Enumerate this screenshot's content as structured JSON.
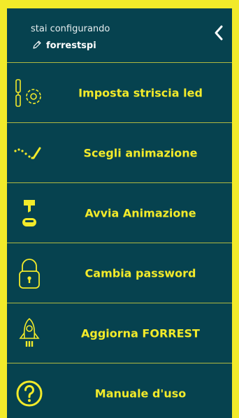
{
  "header": {
    "subtitle": "stai configurando",
    "device_name": "forrestspi",
    "pencil_icon": "pencil-icon",
    "back_icon": "chevron-left-icon"
  },
  "menu": [
    {
      "label": "Imposta striscia led",
      "icon": "led-settings-icon"
    },
    {
      "label": "Scegli animazione",
      "icon": "animation-wave-icon"
    },
    {
      "label": "Avvia Animazione",
      "icon": "play-lamp-icon"
    },
    {
      "label": "Cambia password",
      "icon": "lock-icon"
    },
    {
      "label": "Aggiorna FORREST",
      "icon": "rocket-icon"
    },
    {
      "label": "Manuale d'uso",
      "icon": "help-circle-icon"
    }
  ],
  "colors": {
    "background": "#f2ea2a",
    "panel": "#06424f",
    "accent": "#f2ea2a",
    "text": "#ffffff"
  }
}
